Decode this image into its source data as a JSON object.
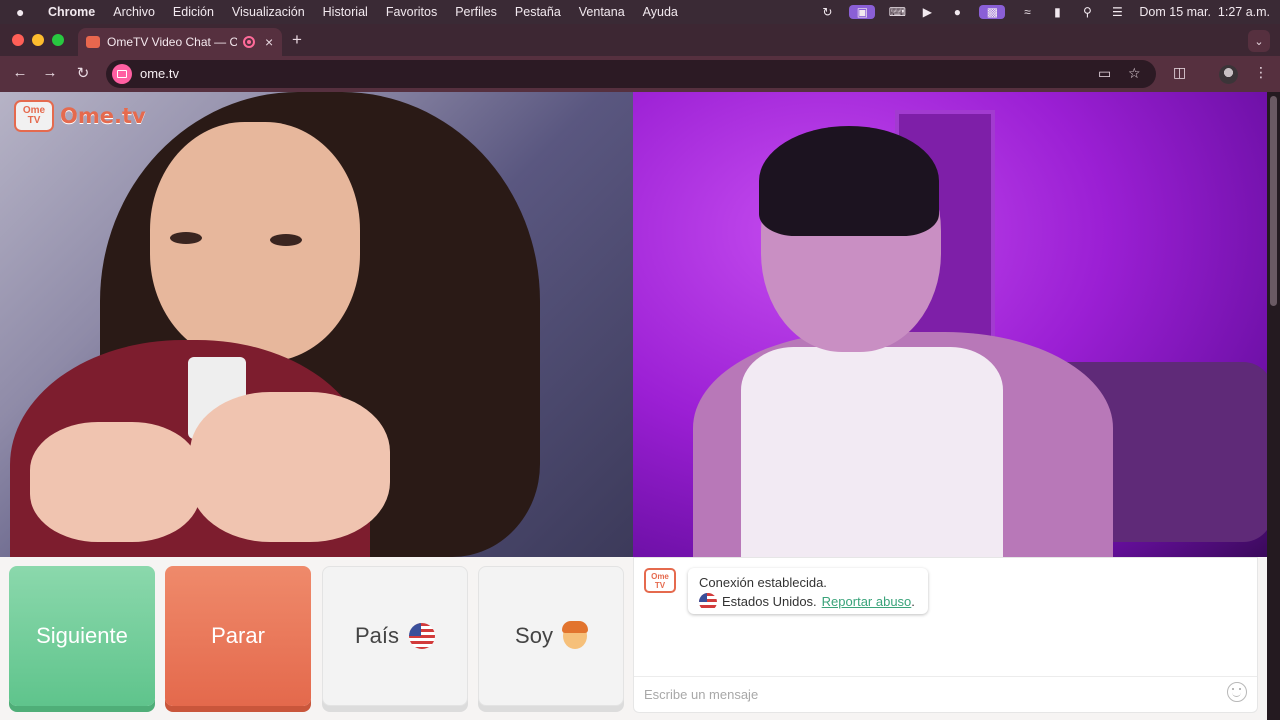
{
  "menubar": {
    "apple": "",
    "app_name": "Chrome",
    "items": [
      "Archivo",
      "Edición",
      "Visualización",
      "Historial",
      "Favoritos",
      "Perfiles",
      "Pestaña",
      "Ventana",
      "Ayuda"
    ],
    "status_icons": [
      "sync-icon",
      "screen-share-icon",
      "keyboard-icon",
      "play-icon",
      "user-icon",
      "mirroring-icon",
      "wifi-icon",
      "battery-icon",
      "search-icon",
      "control-center-icon"
    ],
    "clock": "Dom 15 mar.  1:27 a.m."
  },
  "tabbar": {
    "tab_title": "OmeTV Video Chat — Om",
    "new_tab": "+",
    "tab_close": "×"
  },
  "toolbar": {
    "url": "ome.tv"
  },
  "page": {
    "logo_tv": "Ome TV",
    "logo_text": "Ome.tv",
    "buttons": {
      "next": "Siguiente",
      "stop": "Parar",
      "country": "País",
      "gender": "Soy"
    },
    "chat": {
      "avatar_text": "Ome TV",
      "line1": "Conexión establecida.",
      "country": "Estados Unidos.",
      "report_link": "Reportar abuso",
      "trailing": ".",
      "input_placeholder": "Escribe un mensaje"
    }
  },
  "colors": {
    "next": "#5fc48c",
    "stop": "#e4694c",
    "brand": "#e56a4e",
    "link": "#3aa37a",
    "remote_bg": "#9b1fd4"
  }
}
